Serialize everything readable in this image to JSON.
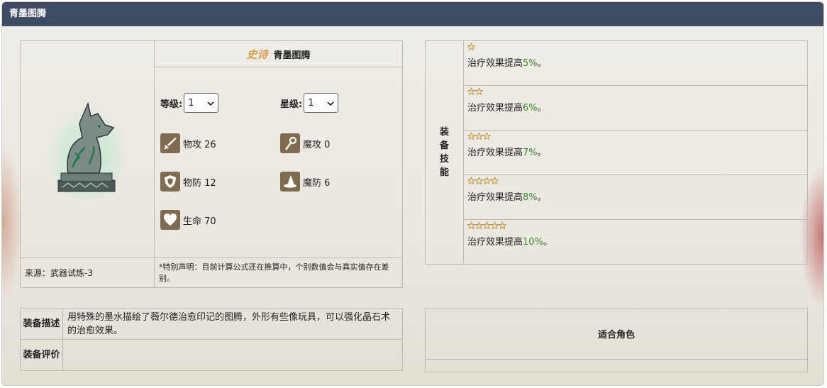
{
  "window": {
    "title": "青墨图腾"
  },
  "item": {
    "rarity": "史诗",
    "name": "青墨图腾",
    "level_label": "等级:",
    "level_value": "1",
    "star_label": "星级:",
    "star_value": "1",
    "stats": {
      "phys_atk": "物攻 26",
      "mag_atk": "魔攻 0",
      "phys_def": "物防 12",
      "mag_def": "魔防 6",
      "hp": "生命 70"
    },
    "source": "来源：武器试炼-3",
    "note": "*特别声明：目前计算公式还在推算中，个别数值会与真实值存在差别。"
  },
  "skills": {
    "header": [
      "装",
      "备",
      "技",
      "能"
    ],
    "rows": [
      {
        "stars": 1,
        "text": "治疗效果提高",
        "pct": "5%",
        "end": "。"
      },
      {
        "stars": 2,
        "text": "治疗效果提高",
        "pct": "6%",
        "end": "。"
      },
      {
        "stars": 3,
        "text": "治疗效果提高",
        "pct": "7%",
        "end": "。"
      },
      {
        "stars": 4,
        "text": "治疗效果提高",
        "pct": "8%",
        "end": "。"
      },
      {
        "stars": 5,
        "text": "治疗效果提高",
        "pct": "10%",
        "end": "。"
      }
    ]
  },
  "desc": {
    "desc_label": "装备描述",
    "desc_text": "用特殊的墨水描绘了薇尔德治愈印记的图腾，外形有些像玩具，可以强化晶石术的治愈效果。",
    "review_label": "装备评价",
    "review_text": ""
  },
  "roles": {
    "header": "适合角色"
  },
  "colors": {
    "titlebar": "#3f4a63",
    "rarity": "#d9a04a",
    "percent": "#3a8a2a",
    "icon_bg": "#7f6c4e"
  }
}
